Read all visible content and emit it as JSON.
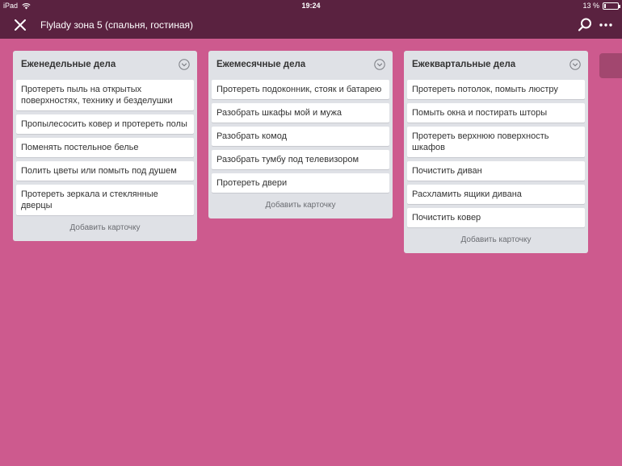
{
  "status": {
    "device": "iPad",
    "time": "19:24",
    "battery_text": "13 %",
    "battery_level": 0.13
  },
  "header": {
    "title": "Flylady зона 5 (спальня, гостиная)"
  },
  "colors": {
    "background": "#cd5a8e",
    "header": "#5a2240",
    "list": "#dfe1e6"
  },
  "lists": [
    {
      "title": "Еженедельные дела",
      "cards": [
        "Протереть пыль на открытых поверхностях, технику  и безделушки",
        "Пропылесосить ковер и протереть полы",
        "Поменять постельное белье",
        "Полить цветы или помыть под душем",
        "Протереть зеркала и стеклянные дверцы"
      ],
      "add_label": "Добавить карточку"
    },
    {
      "title": "Ежемесячные дела",
      "cards": [
        "Протереть подоконник, стояк и батарею",
        "Разобрать шкафы мой и мужа",
        "Разобрать комод",
        "Разобрать тумбу под телевизором",
        "Протереть двери"
      ],
      "add_label": "Добавить карточку"
    },
    {
      "title": "Ежеквартальные дела",
      "cards": [
        "Протереть потолок, помыть люстру",
        "Помыть окна и постирать шторы",
        "Протереть верхнюю поверхность шкафов",
        "Почистить диван",
        "Расхламить ящики дивана",
        "Почистить ковер"
      ],
      "add_label": "Добавить карточку"
    }
  ]
}
